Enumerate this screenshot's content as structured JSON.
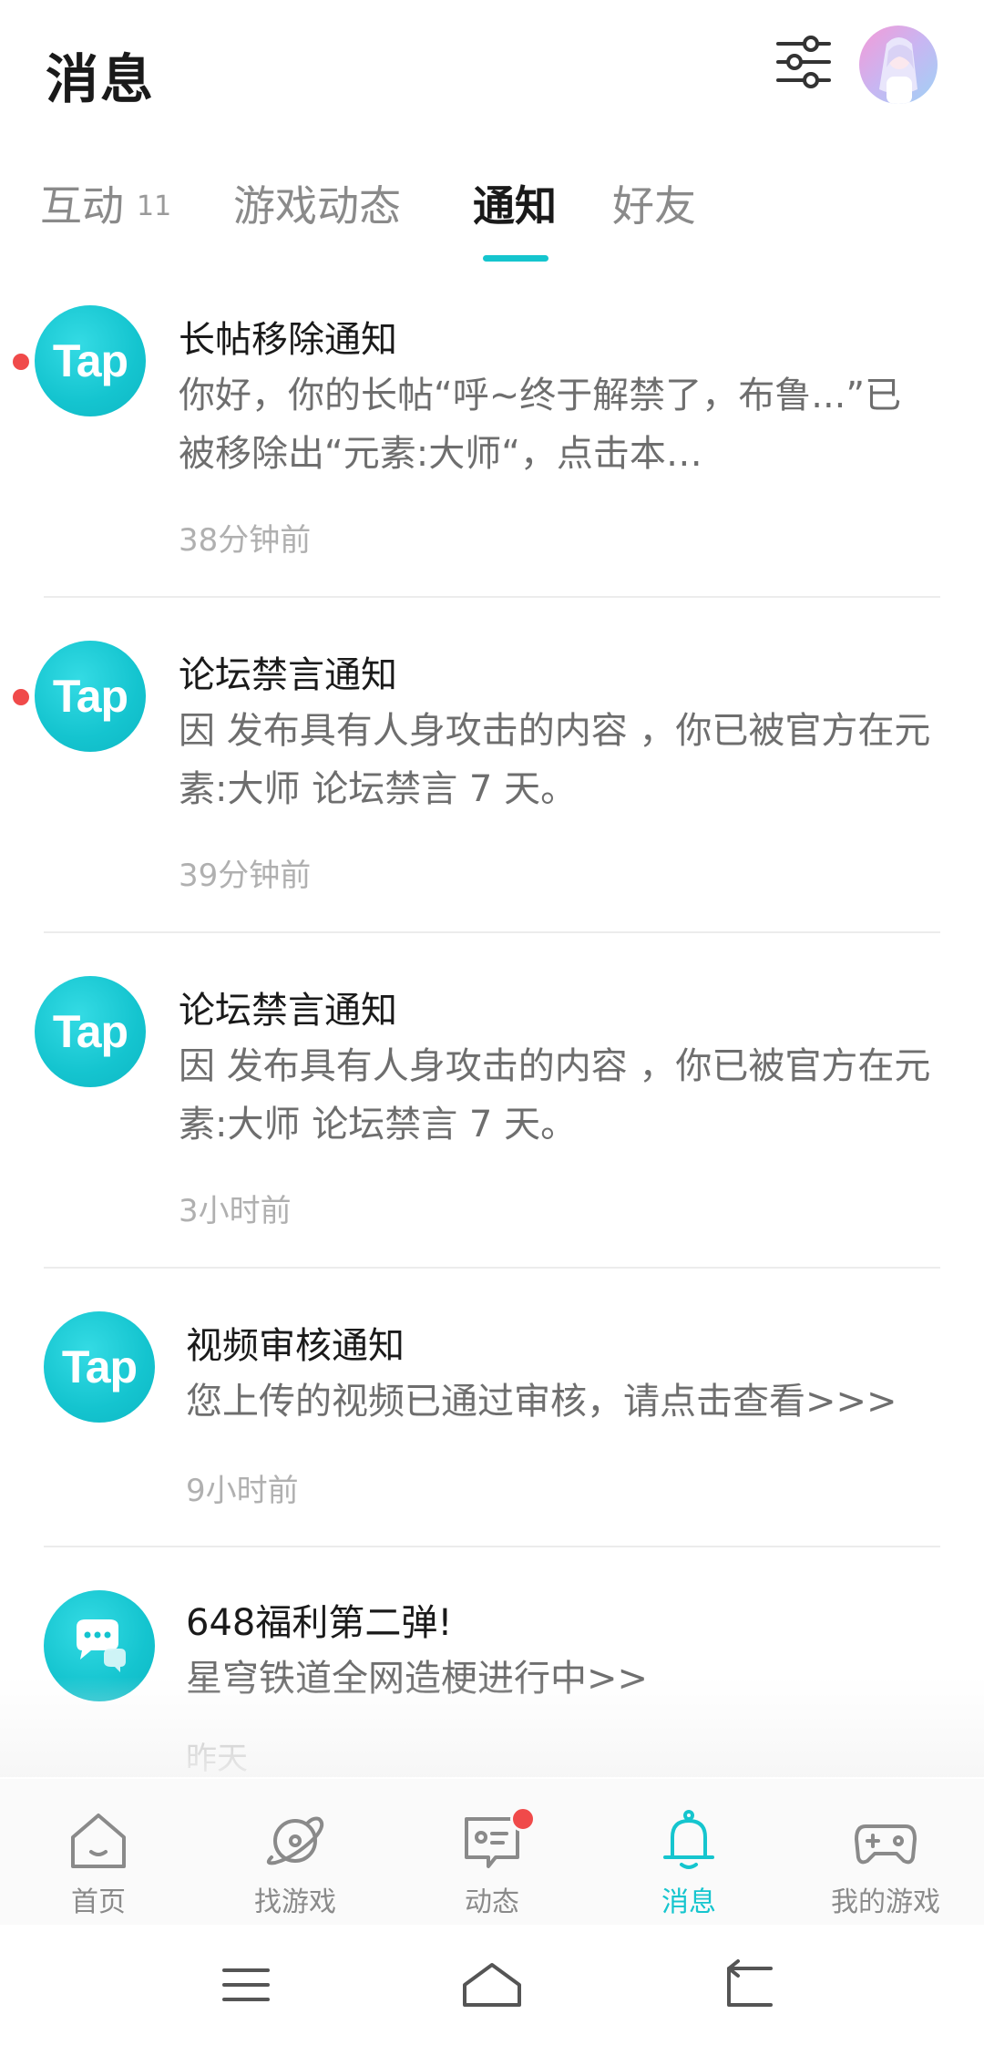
{
  "header": {
    "title": "消息",
    "filter_icon": "sliders-icon",
    "avatar_icon": "user-avatar"
  },
  "tabs": [
    {
      "label": "互动",
      "count": "11",
      "active": false
    },
    {
      "label": "游戏动态",
      "active": false
    },
    {
      "label": "通知",
      "active": true
    },
    {
      "label": "好友",
      "active": false
    }
  ],
  "notifications": [
    {
      "logo": "Tap",
      "unread": true,
      "title": "长帖移除通知",
      "body": "你好，你的长帖“呼~终于解禁了，布鲁...”已被移除出“元素:大师“，点击本…",
      "time": "38分钟前"
    },
    {
      "logo": "Tap",
      "unread": true,
      "title": "论坛禁言通知",
      "body": "因 发布具有人身攻击的内容 ，你已被官方在元素:大师 论坛禁言 7 天。",
      "time": "39分钟前"
    },
    {
      "logo": "Tap",
      "unread": false,
      "title": "论坛禁言通知",
      "body": "因 发布具有人身攻击的内容 ，你已被官方在元素:大师 论坛禁言 7 天。",
      "time": "3小时前"
    },
    {
      "logo": "Tap",
      "unread": false,
      "title": "视频审核通知",
      "body": "您上传的视频已通过审核，请点击查看>>>",
      "time": "9小时前"
    },
    {
      "logo": "chat-bubble-icon",
      "unread": false,
      "title": "648福利第二弹!",
      "body": "星穹铁道全网造梗进行中>>",
      "time": "昨天"
    }
  ],
  "bottom_nav": [
    {
      "label": "首页",
      "icon": "home-icon",
      "active": false
    },
    {
      "label": "找游戏",
      "icon": "planet-icon",
      "active": false
    },
    {
      "label": "动态",
      "icon": "feed-icon",
      "active": false,
      "badge": true
    },
    {
      "label": "消息",
      "icon": "bell-icon",
      "active": true
    },
    {
      "label": "我的游戏",
      "icon": "gamepad-icon",
      "active": false
    }
  ],
  "system_nav": [
    "menu-icon",
    "home-outline-icon",
    "back-icon"
  ],
  "colors": {
    "accent": "#15c5ce",
    "unread": "#f04a4a"
  }
}
